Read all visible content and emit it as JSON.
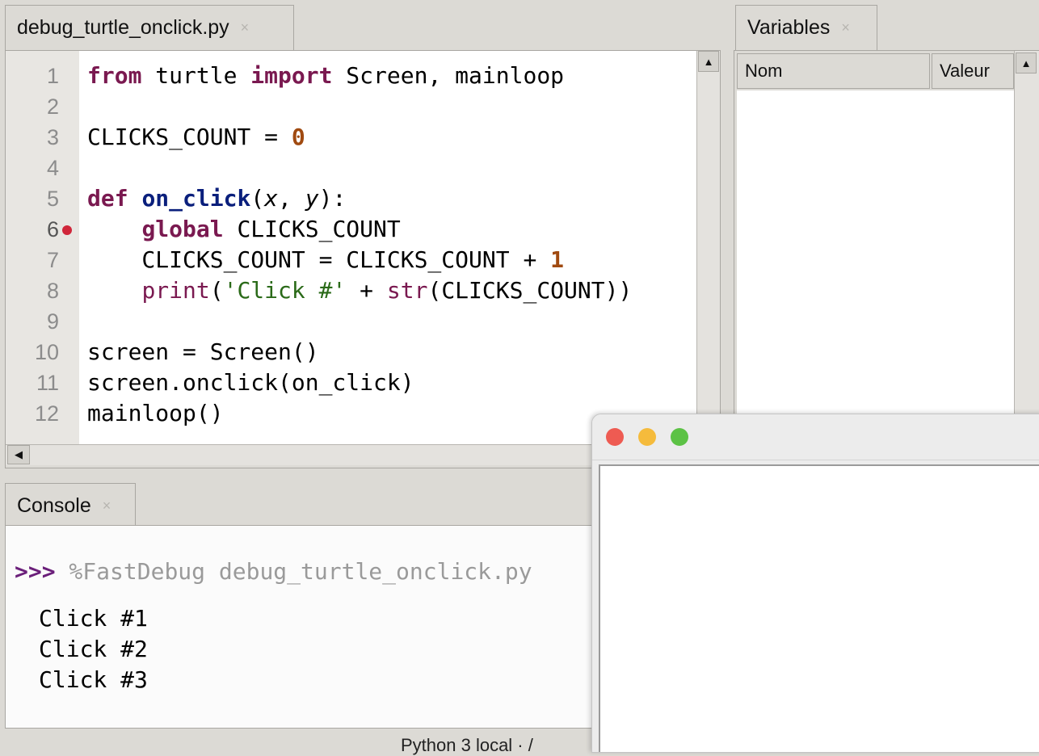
{
  "editor": {
    "tab_title": "debug_turtle_onclick.py",
    "tab_close": "×",
    "line_numbers": [
      "1",
      "2",
      "3",
      "4",
      "5",
      "6",
      "7",
      "8",
      "9",
      "10",
      "11",
      "12"
    ],
    "breakpoint_line": "6",
    "code": {
      "l1_from": "from",
      "l1_a": " turtle ",
      "l1_import": "import",
      "l1_b": " Screen, mainloop",
      "l3_a": "CLICKS_COUNT = ",
      "l3_num": "0",
      "l5_def": "def",
      "l5_sp": " ",
      "l5_fn": "on_click",
      "l5_p1": "(",
      "l5_x": "x",
      "l5_c": ", ",
      "l5_y": "y",
      "l5_p2": "):",
      "l6_indent": "    ",
      "l6_global": "global",
      "l6_b": " CLICKS_COUNT",
      "l7_a": "    CLICKS_COUNT = CLICKS_COUNT + ",
      "l7_num": "1",
      "l8_indent": "    ",
      "l8_print": "print",
      "l8_p1": "(",
      "l8_str": "'Click #'",
      "l8_plus": " + ",
      "l8_strfn": "str",
      "l8_rest": "(CLICKS_COUNT))",
      "l10": "screen = Screen()",
      "l11": "screen.onclick(on_click)",
      "l12": "mainloop()"
    }
  },
  "variables": {
    "tab_title": "Variables",
    "tab_close": "×",
    "col_name": "Nom",
    "col_value": "Valeur"
  },
  "console": {
    "tab_title": "Console",
    "tab_close": "×",
    "prompt": ">>>",
    "command": " %FastDebug debug_turtle_onclick.py",
    "output": [
      "Click #1",
      "Click #2",
      "Click #3"
    ]
  },
  "statusbar": {
    "text": "Python 3 local · /"
  },
  "turtle_window": {
    "close_color": "#ee5b52",
    "minimize_color": "#f5bb3c",
    "zoom_color": "#5cc245"
  }
}
